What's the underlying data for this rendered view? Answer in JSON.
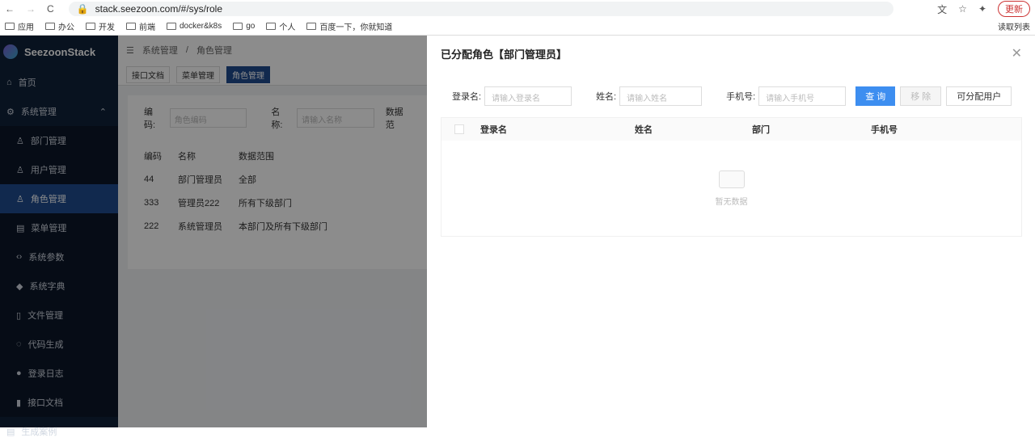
{
  "browser": {
    "url": "stack.seezoon.com/#/sys/role",
    "update": "更新",
    "reading_list": "读取列表",
    "bookmarks": [
      "应用",
      "办公",
      "开发",
      "前端",
      "docker&k8s",
      "go",
      "个人",
      "百度一下，你就知道"
    ]
  },
  "sidebar": {
    "brand": "SeezoonStack",
    "items": [
      {
        "label": "首页",
        "icon": "⌂",
        "sub": false
      },
      {
        "label": "系统管理",
        "icon": "⚙",
        "sub": false
      },
      {
        "label": "部门管理",
        "icon": "♙",
        "sub": true
      },
      {
        "label": "用户管理",
        "icon": "♙",
        "sub": true
      },
      {
        "label": "角色管理",
        "icon": "♙",
        "sub": true,
        "active": true
      },
      {
        "label": "菜单管理",
        "icon": "▤",
        "sub": true
      },
      {
        "label": "系统参数",
        "icon": "‹›",
        "sub": true
      },
      {
        "label": "系统字典",
        "icon": "◆",
        "sub": true
      },
      {
        "label": "文件管理",
        "icon": "▯",
        "sub": true
      },
      {
        "label": "代码生成",
        "icon": "◌",
        "sub": true
      },
      {
        "label": "登录日志",
        "icon": "●",
        "sub": true
      },
      {
        "label": "接口文档",
        "icon": "▮",
        "sub": true
      },
      {
        "label": "生成案例",
        "icon": "▤",
        "sub": false
      }
    ]
  },
  "main": {
    "breadcrumb": [
      "系统管理",
      "角色管理"
    ],
    "tabs": [
      "接口文档",
      "菜单管理",
      "角色管理"
    ],
    "filter": {
      "code_label": "编码:",
      "code_ph": "角色编码",
      "name_label": "名称:",
      "name_ph": "请输入名称",
      "scope_label": "数据范"
    },
    "columns": [
      "编码",
      "名称",
      "数据范围"
    ],
    "rows": [
      [
        "44",
        "部门管理员",
        "全部"
      ],
      [
        "333",
        "管理员222",
        "所有下级部门"
      ],
      [
        "222",
        "系统管理员",
        "本部门及所有下级部门"
      ]
    ]
  },
  "drawer": {
    "title": "已分配角色【部门管理员】",
    "login_label": "登录名:",
    "login_ph": "请输入登录名",
    "name_label": "姓名:",
    "name_ph": "请输入姓名",
    "phone_label": "手机号:",
    "phone_ph": "请输入手机号",
    "query": "查 询",
    "remove": "移 除",
    "assignable": "可分配用户",
    "columns": [
      "登录名",
      "姓名",
      "部门",
      "手机号"
    ],
    "empty": "暂无数据"
  }
}
